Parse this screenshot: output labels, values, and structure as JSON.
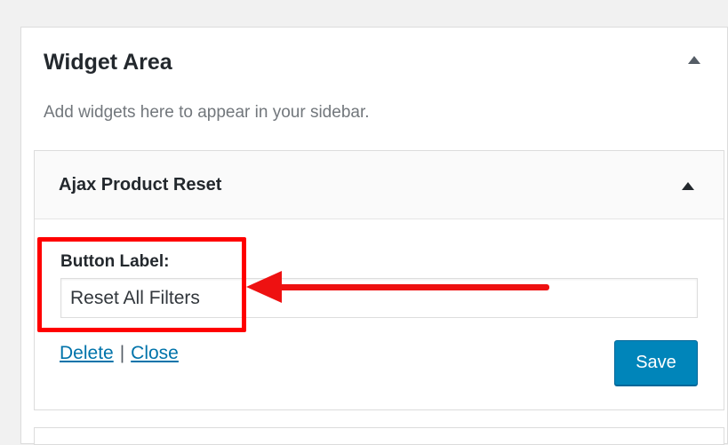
{
  "widget_area": {
    "title": "Widget Area",
    "description": "Add widgets here to appear in your sidebar."
  },
  "widget": {
    "title": "Ajax Product Reset",
    "field_label": "Button Label:",
    "field_value": "Reset All Filters",
    "delete_label": "Delete",
    "separator": "|",
    "close_label": "Close",
    "save_label": "Save"
  },
  "colors": {
    "link": "#0073aa",
    "save_button": "#0085ba",
    "annotation": "#ff0000"
  },
  "icons": {
    "area_toggle": "arrow-up-icon",
    "widget_toggle": "arrow-up-icon"
  }
}
